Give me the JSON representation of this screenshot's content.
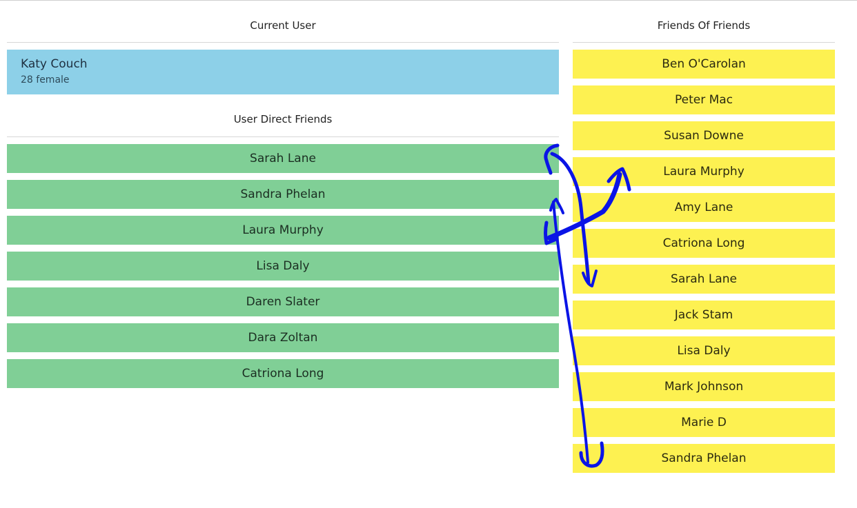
{
  "current_user": {
    "heading": "Current User",
    "name": "Katy Couch",
    "meta": "28 female"
  },
  "direct_friends": {
    "heading": "User Direct Friends",
    "items": [
      "Sarah Lane",
      "Sandra Phelan",
      "Laura Murphy",
      "Lisa Daly",
      "Daren Slater",
      "Dara Zoltan",
      "Catriona Long"
    ]
  },
  "friends_of_friends": {
    "heading": "Friends Of Friends",
    "items": [
      "Ben O'Carolan",
      "Peter Mac",
      "Susan Downe",
      "Laura Murphy",
      "Amy Lane",
      "Catriona Long",
      "Sarah Lane",
      "Jack Stam",
      "Lisa Daly",
      "Mark Johnson",
      "Marie D",
      "Sandra Phelan"
    ]
  },
  "colors": {
    "user_card": "#8dd0e8",
    "direct_friend": "#80cf96",
    "friend_of_friend": "#fdf151",
    "annotation": "#0a14e6"
  }
}
